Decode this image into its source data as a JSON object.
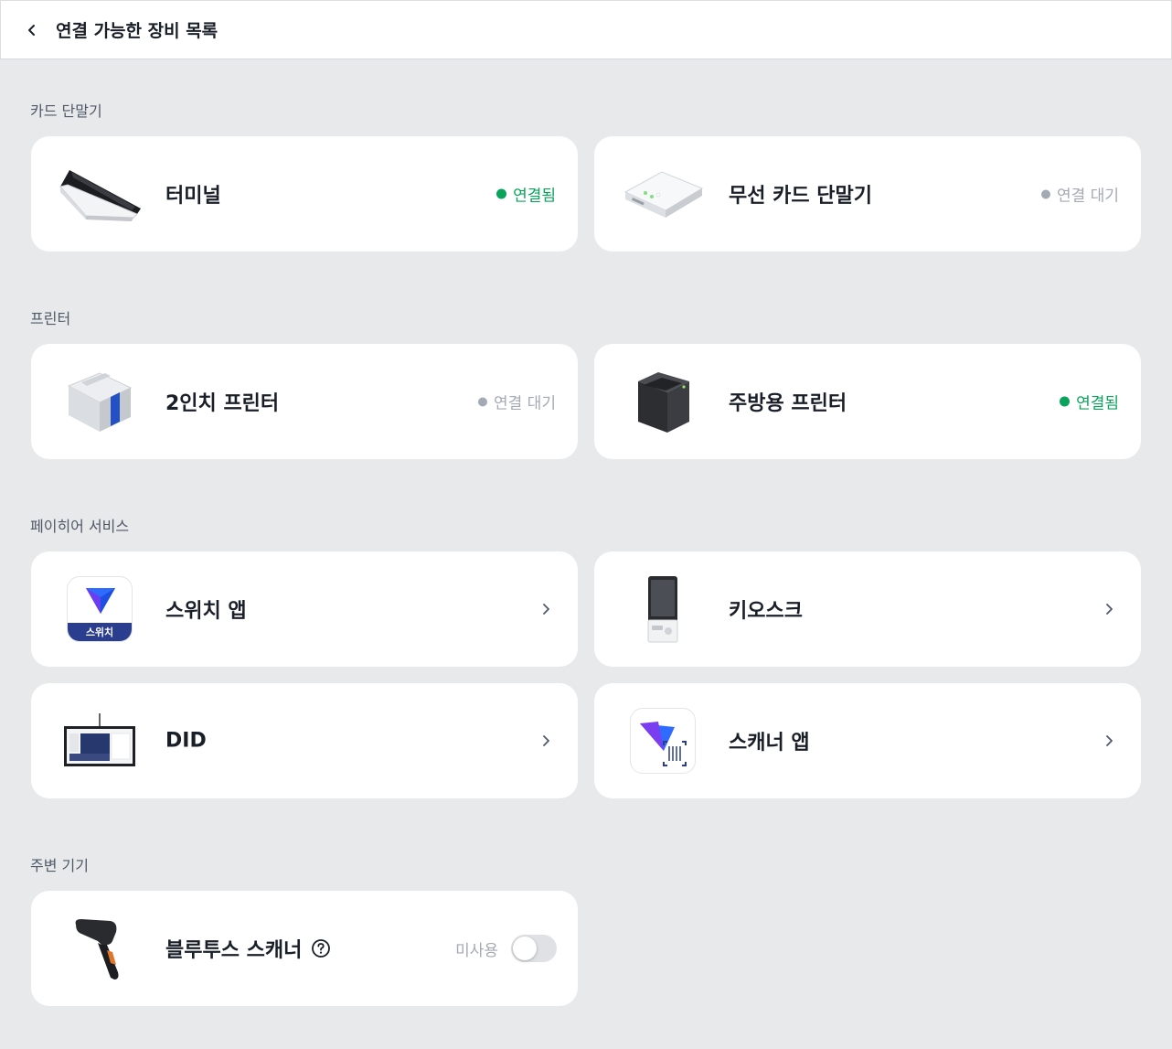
{
  "header": {
    "title": "연결 가능한 장비 목록",
    "back_icon": "chevron-left-icon"
  },
  "colors": {
    "connected": "#0aa35c",
    "waiting": "#a4aab3",
    "brand": "#2b3d8f"
  },
  "sections": {
    "card_terminal": {
      "label": "카드 단말기",
      "items": [
        {
          "name": "터미널",
          "status": "연결됨",
          "connected": true,
          "icon": "card-terminal-image"
        },
        {
          "name": "무선 카드 단말기",
          "status": "연결 대기",
          "connected": false,
          "icon": "wireless-card-reader-image"
        }
      ]
    },
    "printer": {
      "label": "프린터",
      "items": [
        {
          "name": "2인치 프린터",
          "status": "연결 대기",
          "connected": false,
          "icon": "receipt-printer-image"
        },
        {
          "name": "주방용 프린터",
          "status": "연결됨",
          "connected": true,
          "icon": "kitchen-printer-image"
        }
      ]
    },
    "payhere_service": {
      "label": "페이히어 서비스",
      "items": [
        {
          "name": "스위치 앱",
          "icon": "switch-app-icon",
          "badge": "스위치"
        },
        {
          "name": "키오스크",
          "icon": "kiosk-image"
        },
        {
          "name": "DID",
          "icon": "did-display-image"
        },
        {
          "name": "스캐너 앱",
          "icon": "scanner-app-icon"
        }
      ]
    },
    "peripheral": {
      "label": "주변 기기",
      "items": [
        {
          "name": "블루투스 스캐너",
          "toggle_label": "미사용",
          "enabled": false,
          "icon": "barcode-scanner-image"
        }
      ]
    }
  }
}
